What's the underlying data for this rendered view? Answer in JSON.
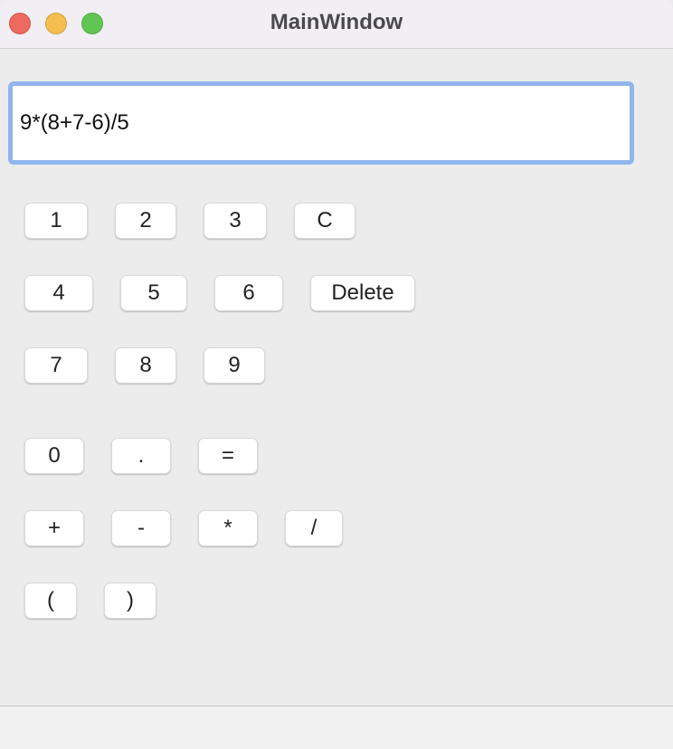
{
  "window": {
    "title": "MainWindow"
  },
  "display": {
    "value": "9*(8+7-6)/5"
  },
  "buttons": {
    "one": "1",
    "two": "2",
    "three": "3",
    "clear": "C",
    "four": "4",
    "five": "5",
    "six": "6",
    "delete": "Delete",
    "seven": "7",
    "eight": "8",
    "nine": "9",
    "zero": "0",
    "dot": ".",
    "equals": "=",
    "plus": "+",
    "minus": "-",
    "multiply": "*",
    "divide": "/",
    "lparen": "(",
    "rparen": ")"
  },
  "colors": {
    "window_bg": "#ececec",
    "titlebar_bg": "#f1eff4",
    "focus_ring": "#91b5ec",
    "close": "#ec6a5e",
    "minimize": "#f4bf4f",
    "zoom": "#61c554"
  }
}
